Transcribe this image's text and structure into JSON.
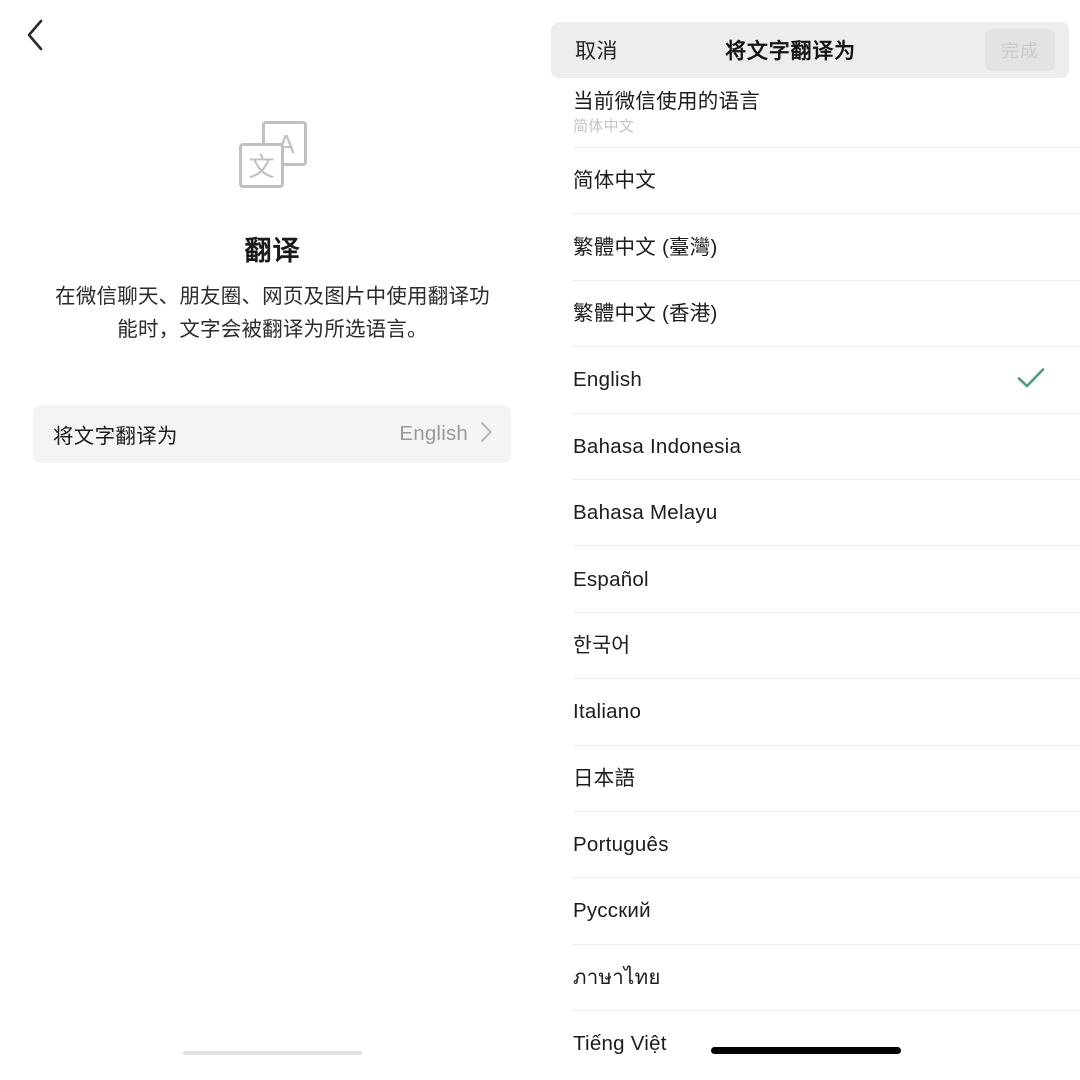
{
  "left_panel": {
    "back_icon": "chevron-left-icon",
    "translate_icon": "translate-icon",
    "icon_glyph_top": "A",
    "icon_glyph_bottom": "文",
    "title": "翻译",
    "description": "在微信聊天、朋友圈、网页及图片中使用翻译功能时，文字会被翻译为所选语言。",
    "settings_row": {
      "label": "将文字翻译为",
      "value": "English",
      "chevron_icon": "chevron-right-icon"
    }
  },
  "right_panel": {
    "header": {
      "cancel_label": "取消",
      "title": "将文字翻译为",
      "done_label": "完成",
      "done_enabled": false
    },
    "current_language": {
      "title": "当前微信使用的语言",
      "subtitle": "简体中文"
    },
    "languages": [
      {
        "label": "简体中文",
        "selected": false
      },
      {
        "label": "繁體中文 (臺灣)",
        "selected": false
      },
      {
        "label": "繁體中文 (香港)",
        "selected": false
      },
      {
        "label": "English",
        "selected": true
      },
      {
        "label": "Bahasa Indonesia",
        "selected": false
      },
      {
        "label": "Bahasa Melayu",
        "selected": false
      },
      {
        "label": "Español",
        "selected": false
      },
      {
        "label": "한국어",
        "selected": false
      },
      {
        "label": "Italiano",
        "selected": false
      },
      {
        "label": "日本語",
        "selected": false
      },
      {
        "label": "Português",
        "selected": false
      },
      {
        "label": "Русский",
        "selected": false
      },
      {
        "label": "ภาษาไทย",
        "selected": false
      },
      {
        "label": "Tiếng Việt",
        "selected": false
      }
    ],
    "check_icon": "check-icon"
  },
  "colors": {
    "accent_check": "#4e9e79",
    "header_bg": "#ededed",
    "row_bg": "#f4f4f4",
    "divider": "#ededed",
    "muted_text": "#9a9a9a",
    "placeholder_text": "#c4c4c4",
    "disabled_button_text": "#c9c9c9"
  }
}
